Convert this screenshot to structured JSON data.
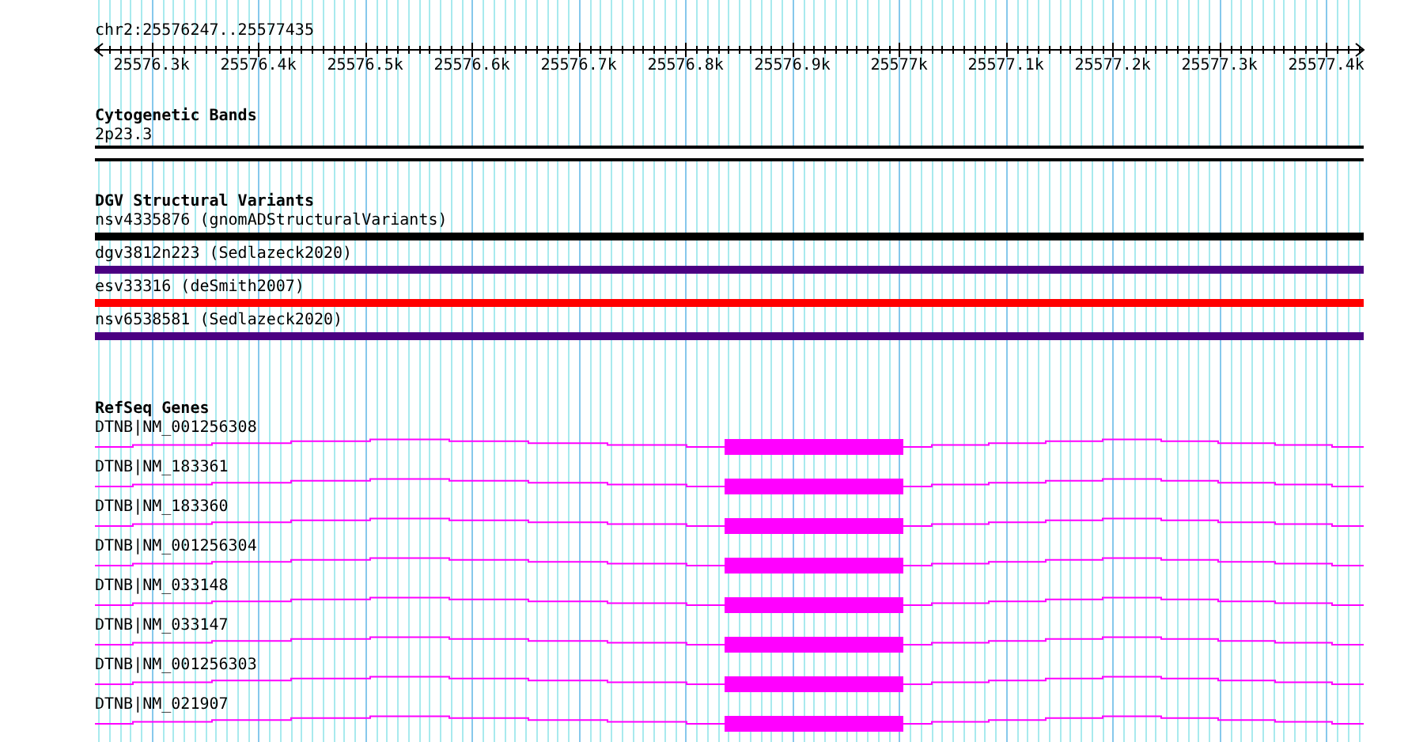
{
  "location": "chr2:25576247..25577435",
  "ruler": {
    "labels": [
      "25576.3k",
      "25576.4k",
      "25576.5k",
      "25576.6k",
      "25576.7k",
      "25576.8k",
      "25576.9k",
      "25577k",
      "25577.1k",
      "25577.2k",
      "25577.3k",
      "25577.4k"
    ]
  },
  "cytogenetic_bands": {
    "title": "Cytogenetic Bands",
    "bands": [
      {
        "name": "2p23.3"
      }
    ]
  },
  "dgv_structural_variants": {
    "title": "DGV Structural Variants",
    "variants": [
      {
        "label": "nsv4335876 (gnomADStructuralVariants)",
        "color": "#000000"
      },
      {
        "label": "dgv3812n223 (Sedlazeck2020)",
        "color": "#4b0082"
      },
      {
        "label": "esv33316 (deSmith2007)",
        "color": "#ff0000"
      },
      {
        "label": "nsv6538581 (Sedlazeck2020)",
        "color": "#4b0082"
      }
    ]
  },
  "refseq_genes": {
    "title": "RefSeq Genes",
    "genes": [
      {
        "name": "DTNB|NM_001256308"
      },
      {
        "name": "DTNB|NM_183361"
      },
      {
        "name": "DTNB|NM_183360"
      },
      {
        "name": "DTNB|NM_001256304"
      },
      {
        "name": "DTNB|NM_033148"
      },
      {
        "name": "DTNB|NM_033147"
      },
      {
        "name": "DTNB|NM_001256303"
      },
      {
        "name": "DTNB|NM_021907"
      }
    ]
  }
}
